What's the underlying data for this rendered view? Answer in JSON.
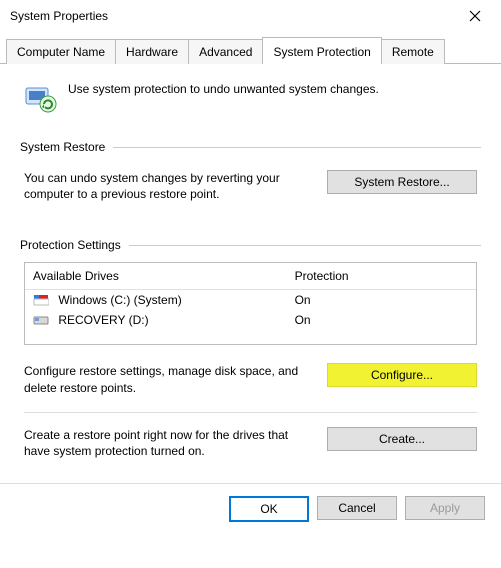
{
  "window": {
    "title": "System Properties"
  },
  "tabs": {
    "computer_name": "Computer Name",
    "hardware": "Hardware",
    "advanced": "Advanced",
    "system_protection": "System Protection",
    "remote": "Remote"
  },
  "intro": {
    "text": "Use system protection to undo unwanted system changes."
  },
  "restore": {
    "group_label": "System Restore",
    "description": "You can undo system changes by reverting your computer to a previous restore point.",
    "button": "System Restore..."
  },
  "protection": {
    "group_label": "Protection Settings",
    "col_drives": "Available Drives",
    "col_protection": "Protection",
    "drives": [
      {
        "name": "Windows (C:) (System)",
        "status": "On",
        "icon": "flag"
      },
      {
        "name": "RECOVERY (D:)",
        "status": "On",
        "icon": "disk"
      }
    ]
  },
  "configure": {
    "description": "Configure restore settings, manage disk space, and delete restore points.",
    "button": "Configure..."
  },
  "create": {
    "description": "Create a restore point right now for the drives that have system protection turned on.",
    "button": "Create..."
  },
  "footer": {
    "ok": "OK",
    "cancel": "Cancel",
    "apply": "Apply"
  }
}
